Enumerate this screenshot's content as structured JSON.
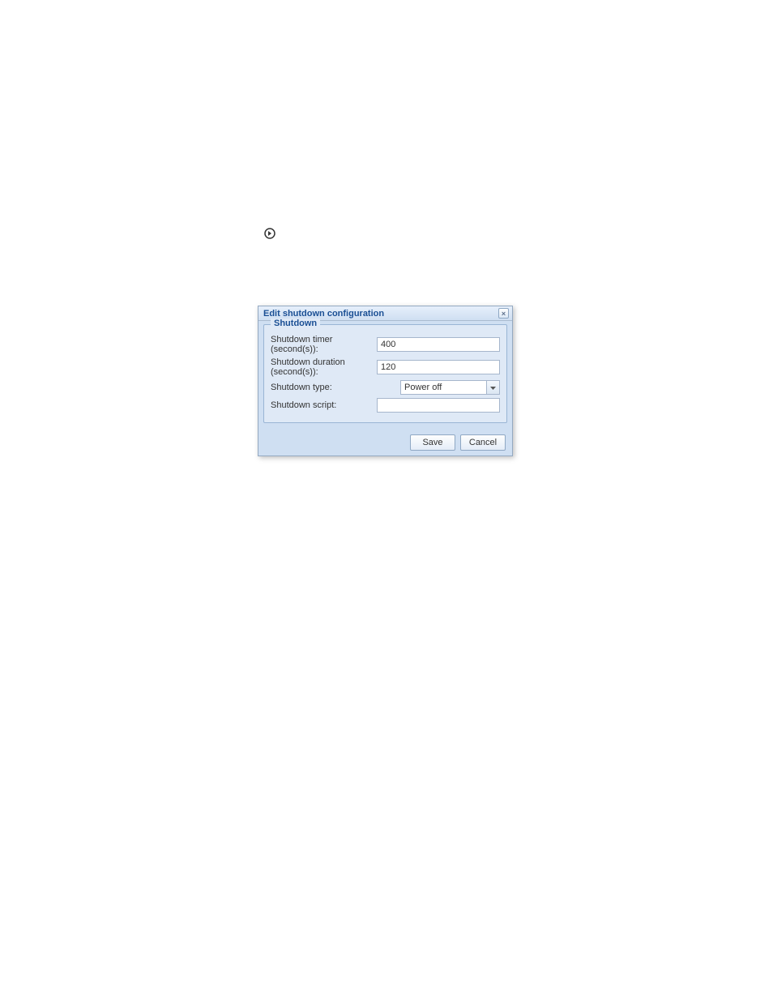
{
  "dialog": {
    "title": "Edit shutdown configuration",
    "close_label": "×",
    "fieldset_legend": "Shutdown",
    "labels": {
      "timer": "Shutdown timer (second(s)):",
      "duration": "Shutdown duration (second(s)):",
      "type": "Shutdown type:",
      "script": "Shutdown script:"
    },
    "values": {
      "timer": "400",
      "duration": "120",
      "type": "Power off",
      "script": ""
    },
    "buttons": {
      "save": "Save",
      "cancel": "Cancel"
    }
  }
}
